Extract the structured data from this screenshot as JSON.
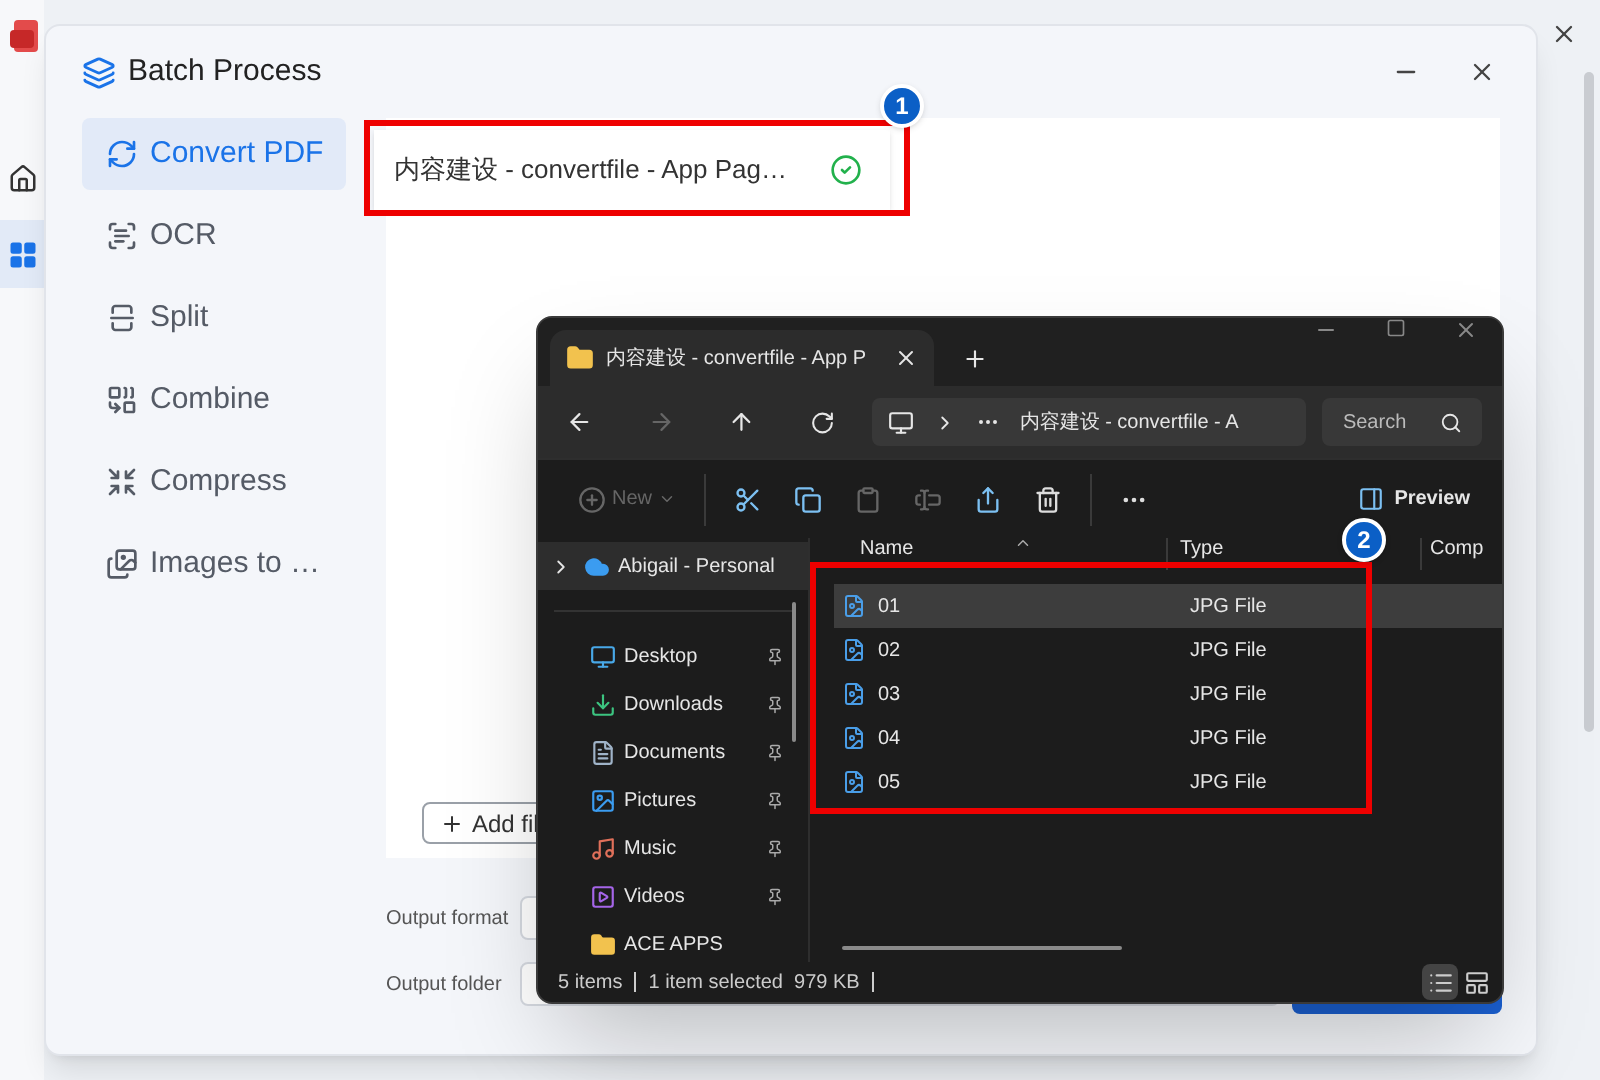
{
  "app": {
    "rail": [
      {
        "kind": "home",
        "selected": false
      },
      {
        "kind": "grid",
        "selected": true
      }
    ]
  },
  "dialog": {
    "title": "Batch Process",
    "sidebar": [
      {
        "kind": "convert",
        "label": "Convert PDF",
        "selected": true
      },
      {
        "kind": "ocr",
        "label": "OCR",
        "selected": false
      },
      {
        "kind": "split",
        "label": "Split",
        "selected": false
      },
      {
        "kind": "combine",
        "label": "Combine",
        "selected": false
      },
      {
        "kind": "compress",
        "label": "Compress",
        "selected": false
      },
      {
        "kind": "images",
        "label": "Images to …",
        "selected": false
      }
    ],
    "files": [
      {
        "name": "内容建设 - convertfile - App Pag…",
        "done": true
      }
    ],
    "add_button": "Add fil",
    "output": [
      {
        "label": "Output format"
      },
      {
        "label": "Output folder"
      }
    ]
  },
  "explorer": {
    "tab_title": "内容建设 - convertfile - App P",
    "path": "内容建设 - convertfile - A",
    "search_placeholder": "Search",
    "toolbar": [
      {
        "kind": "new",
        "label": "New",
        "disabled": true
      },
      {
        "kind": "cut",
        "disabled": false
      },
      {
        "kind": "copy",
        "disabled": false
      },
      {
        "kind": "paste",
        "disabled": true
      },
      {
        "kind": "rename",
        "disabled": true
      },
      {
        "kind": "share",
        "disabled": false
      },
      {
        "kind": "delete",
        "disabled": false
      },
      {
        "kind": "more",
        "disabled": false
      }
    ],
    "preview": "Preview",
    "nav": [
      {
        "kind": "cloud",
        "label": "Abigail - Personal",
        "selected": true,
        "pinned": false
      },
      {
        "kind": "desktop",
        "label": "Desktop",
        "selected": false,
        "pinned": true
      },
      {
        "kind": "downloads",
        "label": "Downloads",
        "selected": false,
        "pinned": true
      },
      {
        "kind": "documents",
        "label": "Documents",
        "selected": false,
        "pinned": true
      },
      {
        "kind": "pictures",
        "label": "Pictures",
        "selected": false,
        "pinned": true
      },
      {
        "kind": "music",
        "label": "Music",
        "selected": false,
        "pinned": true
      },
      {
        "kind": "videos",
        "label": "Videos",
        "selected": false,
        "pinned": true
      },
      {
        "kind": "folder",
        "label": "ACE APPS",
        "selected": false,
        "pinned": false
      }
    ],
    "columns": [
      "Name",
      "Type",
      "Comp"
    ],
    "rows": [
      {
        "name": "01",
        "type": "JPG File",
        "selected": true
      },
      {
        "name": "02",
        "type": "JPG File",
        "selected": false
      },
      {
        "name": "03",
        "type": "JPG File",
        "selected": false
      },
      {
        "name": "04",
        "type": "JPG File",
        "selected": false
      },
      {
        "name": "05",
        "type": "JPG File",
        "selected": false
      }
    ],
    "status": [
      "5 items",
      "1 item selected  979 KB"
    ],
    "views": [
      {
        "kind": "details",
        "selected": true
      },
      {
        "kind": "tiles",
        "selected": false
      }
    ]
  },
  "annotations": [
    {
      "number": "1"
    },
    {
      "number": "2"
    }
  ]
}
